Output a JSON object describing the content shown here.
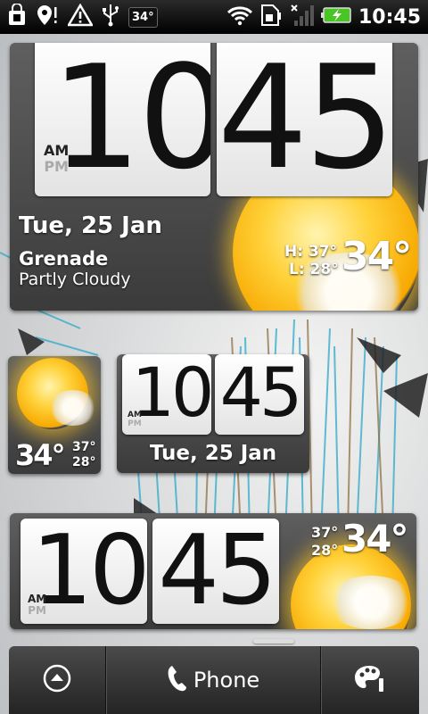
{
  "status_bar": {
    "temperature": "34°",
    "time": "10:45",
    "icons": [
      "shopping-bag-icon",
      "location-pin-icon",
      "warning-icon",
      "usb-icon",
      "wifi-icon",
      "sim-card-icon",
      "no-signal-icon",
      "battery-charging-icon"
    ]
  },
  "widget_large": {
    "hour": "10",
    "minute": "45",
    "am": "AM",
    "pm": "PM",
    "date": "Tue, 25 Jan",
    "city": "Grenade",
    "condition": "Partly Cloudy",
    "high": "H: 37°",
    "low": "L: 28°",
    "current": "34°"
  },
  "widget_weather_small": {
    "current": "34°",
    "high": "37°",
    "low": "28°"
  },
  "widget_clock_medium": {
    "hour": "10",
    "minute": "45",
    "am": "AM",
    "pm": "PM",
    "date": "Tue, 25 Jan"
  },
  "widget_wide": {
    "hour": "10",
    "minute": "45",
    "am": "AM",
    "pm": "PM",
    "high": "37°",
    "low": "28°",
    "current": "34°"
  },
  "dock": {
    "phone_label": "Phone",
    "icons": [
      "app-drawer-up-icon",
      "phone-icon",
      "personalize-icon"
    ]
  },
  "colors": {
    "battery": "#4bc427",
    "panel": "#4a4a4a",
    "sun": "#ffc21a",
    "wallpaper_accent": "#2fb6d6"
  }
}
